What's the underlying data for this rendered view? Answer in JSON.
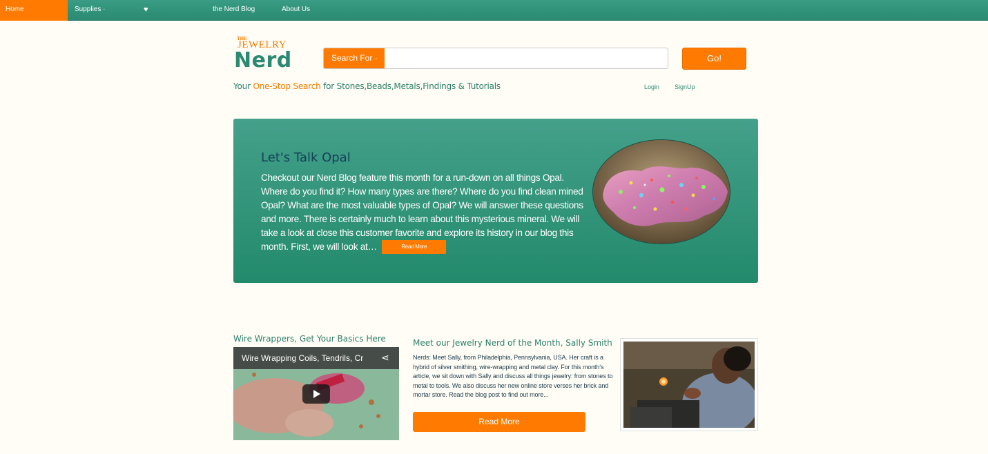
{
  "nav": {
    "home": "Home",
    "supplies": "Supplies ·",
    "favorites_icon": "heart-icon",
    "blog": "the Nerd Blog",
    "about": "About Us"
  },
  "logo": {
    "the": "THE",
    "jewelry": "JEWELRY",
    "nerd": "Nerd"
  },
  "search": {
    "label": "Search For ·",
    "value": "",
    "go": "Go!"
  },
  "tagline": {
    "prefix": "Your ",
    "accent": "One-Stop Search",
    "suffix": " for Stones,Beads,Metals,Findings & Tutorials"
  },
  "auth": {
    "login": "Login",
    "signup": "SignUp"
  },
  "hero": {
    "title": "Let's Talk Opal",
    "text": "Checkout our Nerd Blog feature this month for a run-down on all things Opal. Where do you find it? How many types are there? Where do you find clean mined Opal? What are the most valuable types of Opal? We will answer these questions and more. There is certainly much to learn about this mysterious mineral. We will take a look at close this customer favorite and explore its history in our blog this month. First, we will look at…",
    "read_more": "Read More"
  },
  "wire": {
    "title": "Wire Wrappers, Get Your Basics Here",
    "video_title": "Wire Wrapping Coils, Tendrils, Cr"
  },
  "nerd_month": {
    "title": "Meet our Jewelry Nerd of the Month, Sally Smith",
    "text": "Nerds: Meet Sally, from Philadelphia, Pennsylvania, USA. Her craft is a hybrid of silver smithing, wire-wrapping and metal clay. For this month's article, we sit down with Sally and discuss all things jewelry: from stones to metal to tools. We also discuss her new online store verses her brick and mortar store. Read the blog post to find out more...",
    "read_more": "Read More"
  },
  "colors": {
    "accent": "#ff7a00",
    "brand": "#2a8a72"
  }
}
